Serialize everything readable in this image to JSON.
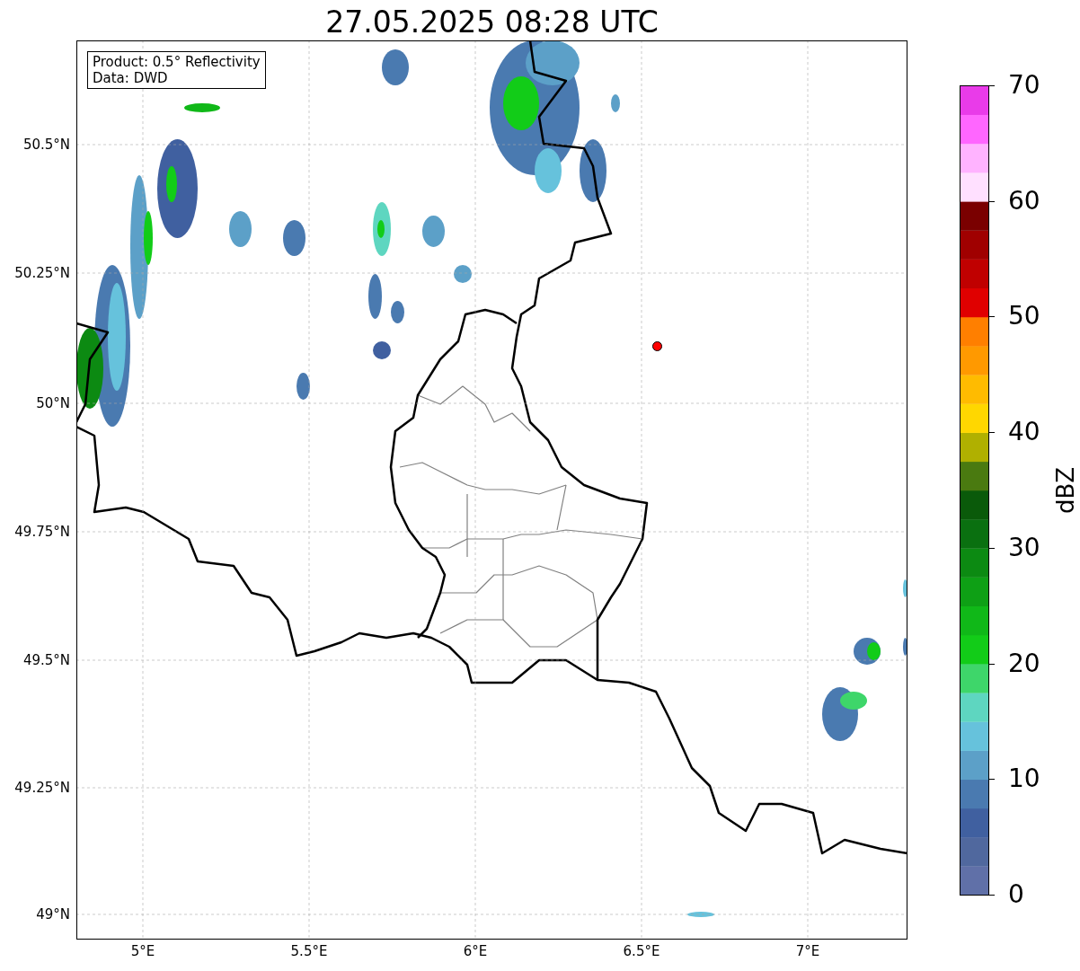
{
  "title": "27.05.2025 08:28 UTC",
  "info_box": [
    "Product: 0.5° Reflectivity",
    "Data: DWD"
  ],
  "map": {
    "y_ticks": [
      "50.5°N",
      "50.25°N",
      "50°N",
      "49.75°N",
      "49.5°N",
      "49.25°N",
      "49°N"
    ],
    "x_ticks": [
      "5°E",
      "5.5°E",
      "6°E",
      "6.5°E",
      "7°E"
    ]
  },
  "colorbar": {
    "label": "dBZ",
    "ticks": [
      "70",
      "60",
      "50",
      "40",
      "30",
      "20",
      "10",
      "0"
    ],
    "bins": [
      {
        "color": "#6070a8"
      },
      {
        "color": "#50689e"
      },
      {
        "color": "#4060a0"
      },
      {
        "color": "#4a7ab0"
      },
      {
        "color": "#5ca0c8"
      },
      {
        "color": "#66c2dc"
      },
      {
        "color": "#5ed6c0"
      },
      {
        "color": "#3ed66a"
      },
      {
        "color": "#12cc18"
      },
      {
        "color": "#10b818"
      },
      {
        "color": "#0ea015"
      },
      {
        "color": "#0c8a12"
      },
      {
        "color": "#0a7010"
      },
      {
        "color": "#0a5a0a"
      },
      {
        "color": "#4a7a10"
      },
      {
        "color": "#b0b000"
      },
      {
        "color": "#ffd700"
      },
      {
        "color": "#ffbb00"
      },
      {
        "color": "#ff9900"
      },
      {
        "color": "#ff7f00"
      },
      {
        "color": "#e00000"
      },
      {
        "color": "#c00000"
      },
      {
        "color": "#a00000"
      },
      {
        "color": "#7a0000"
      },
      {
        "color": "#ffe0ff"
      },
      {
        "color": "#ffb3ff"
      },
      {
        "color": "#ff66ff"
      },
      {
        "color": "#e93be9"
      }
    ]
  }
}
